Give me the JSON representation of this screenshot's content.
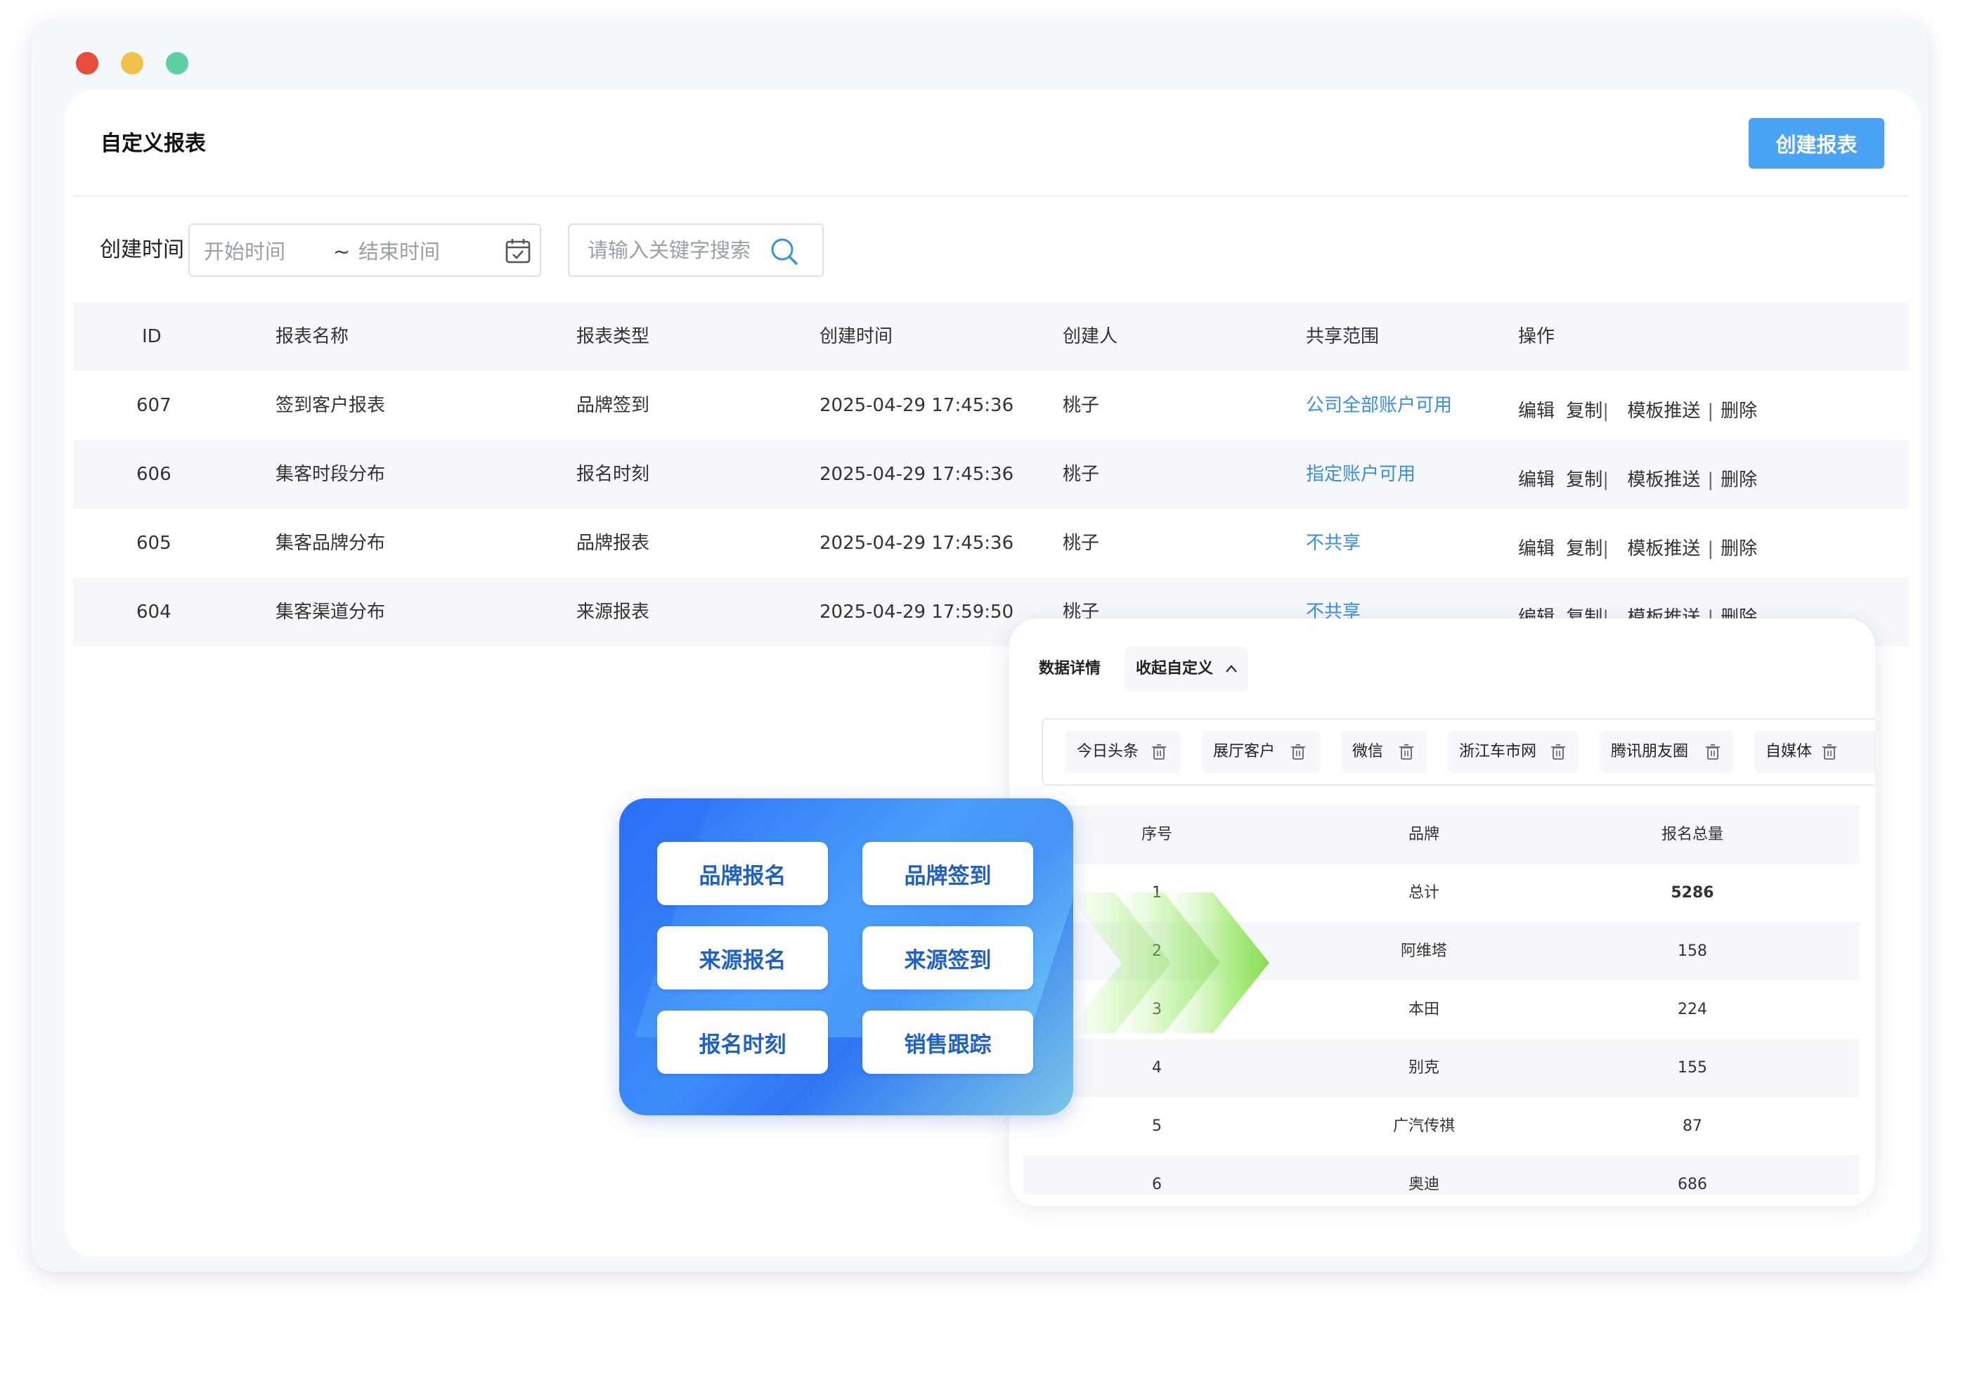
{
  "window": {
    "controls": [
      "close",
      "minimize",
      "maximize"
    ]
  },
  "header": {
    "title": "自定义报表",
    "create_button": "创建报表"
  },
  "filters": {
    "created_label": "创建时间",
    "start_placeholder": "开始时间",
    "separator": "~",
    "end_placeholder": "结束时间",
    "search_placeholder": "请输入关键字搜索",
    "calendar_icon": "calendar-icon",
    "search_icon": "search-icon"
  },
  "table": {
    "columns": [
      "ID",
      "报表名称",
      "报表类型",
      "创建时间",
      "创建人",
      "共享范围",
      "操作"
    ],
    "rows": [
      {
        "id": "607",
        "name": "签到客户报表",
        "type": "品牌签到",
        "created": "2025-04-29 17:45:36",
        "creator": "桃子",
        "scope": "公司全部账户可用"
      },
      {
        "id": "606",
        "name": "集客时段分布",
        "type": "报名时刻",
        "created": "2025-04-29 17:45:36",
        "creator": "桃子",
        "scope": "指定账户可用"
      },
      {
        "id": "605",
        "name": "集客品牌分布",
        "type": "品牌报表",
        "created": "2025-04-29 17:45:36",
        "creator": "桃子",
        "scope": "不共享"
      },
      {
        "id": "604",
        "name": "集客渠道分布",
        "type": "来源报表",
        "created": "2025-04-29 17:59:50",
        "creator": "桃子",
        "scope": "不共享"
      }
    ],
    "actions": {
      "edit": "编辑",
      "copy": "复制",
      "bar": "|",
      "push": "模板推送",
      "delete": "删除"
    }
  },
  "detail": {
    "title": "数据详情",
    "toggle": "收起自定义",
    "tags": [
      "今日头条",
      "展厅客户",
      "微信",
      "浙江车市网",
      "腾讯朋友圈",
      "自媒体"
    ],
    "columns": [
      "序号",
      "品牌",
      "报名总量"
    ],
    "rows": [
      {
        "no": "1",
        "brand": "总计",
        "total": "5286"
      },
      {
        "no": "2",
        "brand": "阿维塔",
        "total": "158"
      },
      {
        "no": "3",
        "brand": "本田",
        "total": "224"
      },
      {
        "no": "4",
        "brand": "别克",
        "total": "155"
      },
      {
        "no": "5",
        "brand": "广汽传祺",
        "total": "87"
      },
      {
        "no": "6",
        "brand": "奥迪",
        "total": "686"
      }
    ]
  },
  "report_types": [
    "品牌报名",
    "品牌签到",
    "来源报名",
    "来源签到",
    "报名时刻",
    "销售跟踪"
  ],
  "colors": {
    "accent": "#4aa3f5",
    "link": "#3a8ee6",
    "card_blue": "#2f76f4",
    "arrow_green": "#8fe35b"
  }
}
